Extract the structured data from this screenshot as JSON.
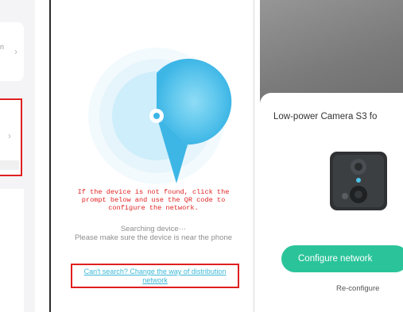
{
  "panel_left": {
    "card1_fragment": "n",
    "chevron": "›"
  },
  "panel_middle": {
    "not_found_note": [
      "If the device is not found, click the",
      "prompt below and use the QR code to",
      "configure the network."
    ],
    "searching_text": "Searching device···",
    "near_phone_text": "Please make sure the device is near the phone",
    "switch_link": [
      "Can't search? Change the way of distribution",
      "network"
    ]
  },
  "panel_right": {
    "device_title": "Low-power Camera S3 fo",
    "configure_button": "Configure network",
    "reconfigure_link": "Re-configure"
  },
  "colors": {
    "accent_green": "#2bc49a",
    "highlight_red": "#e02020",
    "note_red": "#e22424",
    "link_blue": "#3bb8d6",
    "radar_blue": "#5bc8ee"
  },
  "icons": [
    "chevron-right-icon",
    "radar-scan-icon",
    "camera-device-icon"
  ]
}
